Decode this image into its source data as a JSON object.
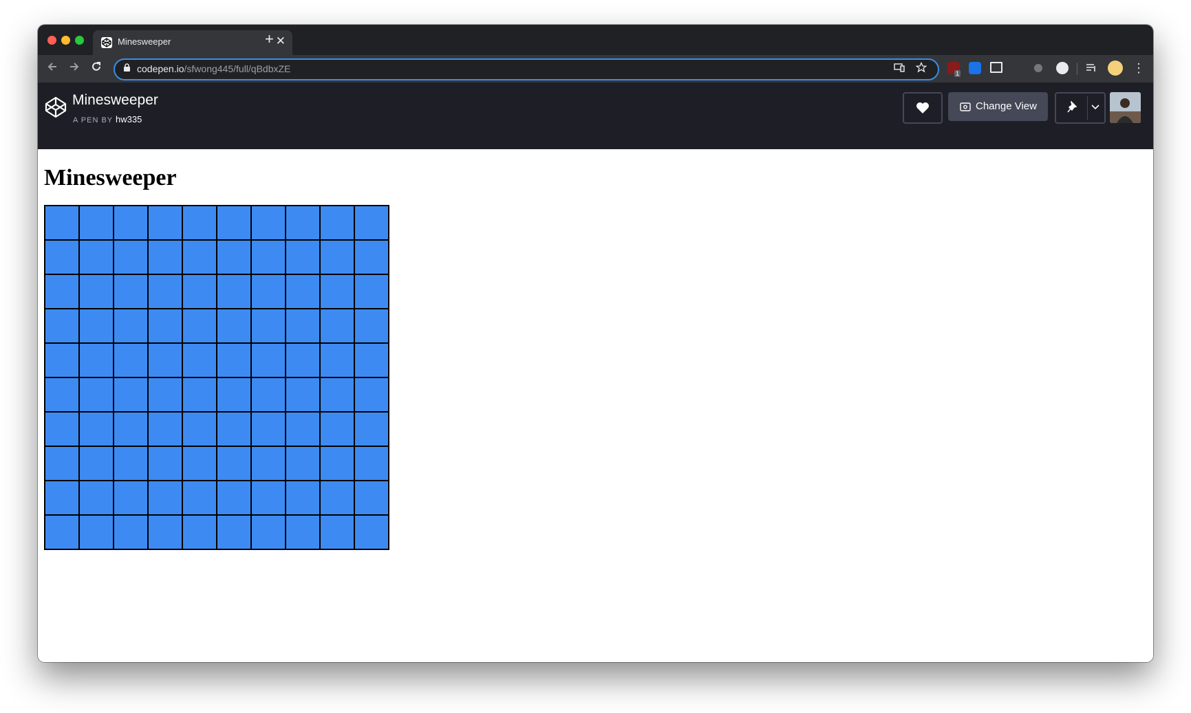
{
  "browser": {
    "tab_title": "Minesweeper",
    "tab_close": "✕",
    "new_tab": "+",
    "url_host": "codepen.io",
    "url_path": "/sfwong445/full/qBdbxZE",
    "extension_badge": "1"
  },
  "codepen": {
    "pen_title": "Minesweeper",
    "byline_prefix": "A PEN BY",
    "author": "hw335",
    "change_view_label": "Change View"
  },
  "page": {
    "heading": "Minesweeper"
  },
  "board": {
    "rows": 10,
    "cols": 10,
    "cell_color": "#3d8bf2"
  },
  "icons": {
    "back": "arrow-left",
    "forward": "arrow-right",
    "reload": "reload",
    "lock": "lock",
    "cast": "cast",
    "bookmark": "star",
    "heart": "heart",
    "eye": "eye",
    "pin": "pin",
    "chevron": "chevron-down"
  }
}
